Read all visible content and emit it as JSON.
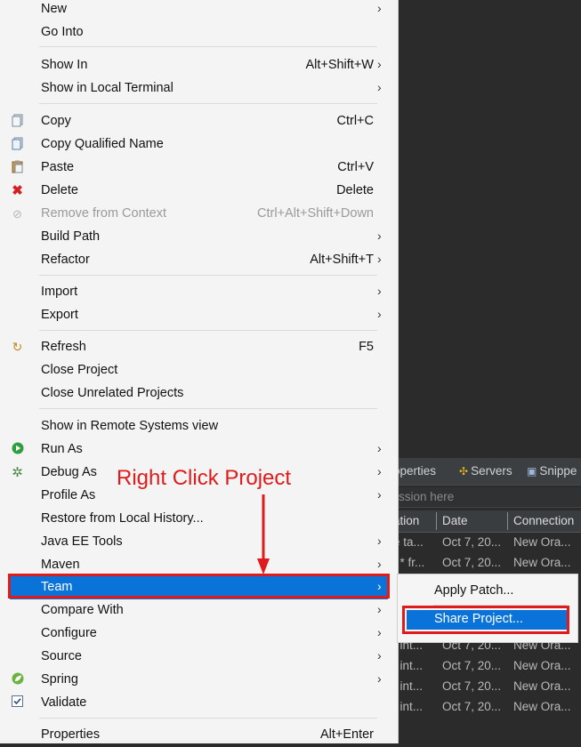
{
  "context_menu": {
    "items": [
      {
        "label": "New",
        "shortcut": "",
        "submenu": true,
        "icon": "",
        "disabled": false
      },
      {
        "label": "Go Into",
        "shortcut": "",
        "submenu": false,
        "icon": "",
        "disabled": false
      },
      {
        "label": "Show In",
        "shortcut": "Alt+Shift+W",
        "submenu": true,
        "icon": "",
        "disabled": false
      },
      {
        "label": "Show in Local Terminal",
        "shortcut": "",
        "submenu": true,
        "icon": "",
        "disabled": false
      },
      {
        "label": "Copy",
        "shortcut": "Ctrl+C",
        "submenu": false,
        "icon": "copy-icon",
        "disabled": false
      },
      {
        "label": "Copy Qualified Name",
        "shortcut": "",
        "submenu": false,
        "icon": "copy-qualified-name-icon",
        "disabled": false
      },
      {
        "label": "Paste",
        "shortcut": "Ctrl+V",
        "submenu": false,
        "icon": "paste-icon",
        "disabled": false
      },
      {
        "label": "Delete",
        "shortcut": "Delete",
        "submenu": false,
        "icon": "delete-icon",
        "disabled": false
      },
      {
        "label": "Remove from Context",
        "shortcut": "Ctrl+Alt+Shift+Down",
        "submenu": false,
        "icon": "remove-context-icon",
        "disabled": true
      },
      {
        "label": "Build Path",
        "shortcut": "",
        "submenu": true,
        "icon": "",
        "disabled": false
      },
      {
        "label": "Refactor",
        "shortcut": "Alt+Shift+T",
        "submenu": true,
        "icon": "",
        "disabled": false
      },
      {
        "label": "Import",
        "shortcut": "",
        "submenu": true,
        "icon": "",
        "disabled": false
      },
      {
        "label": "Export",
        "shortcut": "",
        "submenu": true,
        "icon": "",
        "disabled": false
      },
      {
        "label": "Refresh",
        "shortcut": "F5",
        "submenu": false,
        "icon": "refresh-icon",
        "disabled": false
      },
      {
        "label": "Close Project",
        "shortcut": "",
        "submenu": false,
        "icon": "",
        "disabled": false
      },
      {
        "label": "Close Unrelated Projects",
        "shortcut": "",
        "submenu": false,
        "icon": "",
        "disabled": false
      },
      {
        "label": "Show in Remote Systems view",
        "shortcut": "",
        "submenu": false,
        "icon": "",
        "disabled": false
      },
      {
        "label": "Run As",
        "shortcut": "",
        "submenu": true,
        "icon": "run-icon",
        "disabled": false
      },
      {
        "label": "Debug As",
        "shortcut": "",
        "submenu": true,
        "icon": "debug-bug-icon",
        "disabled": false
      },
      {
        "label": "Profile As",
        "shortcut": "",
        "submenu": true,
        "icon": "",
        "disabled": false
      },
      {
        "label": "Restore from Local History...",
        "shortcut": "",
        "submenu": false,
        "icon": "",
        "disabled": false
      },
      {
        "label": "Java EE Tools",
        "shortcut": "",
        "submenu": true,
        "icon": "",
        "disabled": false
      },
      {
        "label": "Maven",
        "shortcut": "",
        "submenu": true,
        "icon": "",
        "disabled": false
      },
      {
        "label": "Team",
        "shortcut": "",
        "submenu": true,
        "icon": "",
        "disabled": false,
        "highlighted": true
      },
      {
        "label": "Compare With",
        "shortcut": "",
        "submenu": true,
        "icon": "",
        "disabled": false
      },
      {
        "label": "Configure",
        "shortcut": "",
        "submenu": true,
        "icon": "",
        "disabled": false
      },
      {
        "label": "Source",
        "shortcut": "",
        "submenu": true,
        "icon": "",
        "disabled": false
      },
      {
        "label": "Spring",
        "shortcut": "",
        "submenu": true,
        "icon": "spring-leaf-icon",
        "disabled": false
      },
      {
        "label": "Validate",
        "shortcut": "",
        "submenu": false,
        "icon": "validate-checkbox-icon",
        "disabled": false
      },
      {
        "label": "Properties",
        "shortcut": "Alt+Enter",
        "submenu": false,
        "icon": "",
        "disabled": false
      }
    ]
  },
  "team_submenu": {
    "items": [
      {
        "label": "Apply Patch..."
      },
      {
        "label": "Share Project...",
        "highlighted": true
      }
    ]
  },
  "annotation": {
    "text": "Right Click Project",
    "color": "#e01b1b"
  },
  "bottom_panel": {
    "tabs": [
      "operties",
      "Servers",
      "Snippe"
    ],
    "filter_placeholder": "ssion here",
    "columns": [
      "ation",
      "Date",
      "Connection"
    ],
    "rows": [
      [
        "e ta...",
        "Oct 7, 20...",
        "New Ora..."
      ],
      [
        "t * fr...",
        "Oct 7, 20...",
        "New Ora..."
      ],
      [
        "t int...",
        "Oct 7, 20...",
        "New Ora..."
      ],
      [
        "t int...",
        "Oct 7, 20...",
        "New Ora..."
      ],
      [
        "t int...",
        "Oct 7, 20...",
        "New Ora..."
      ],
      [
        "t int...",
        "Oct 7, 20...",
        "New Ora..."
      ]
    ]
  },
  "colors": {
    "highlight": "#0a73d9",
    "annotation_red": "#e01b1b",
    "menu_bg": "#f4f4f4",
    "ide_bg": "#2b2b2b"
  }
}
